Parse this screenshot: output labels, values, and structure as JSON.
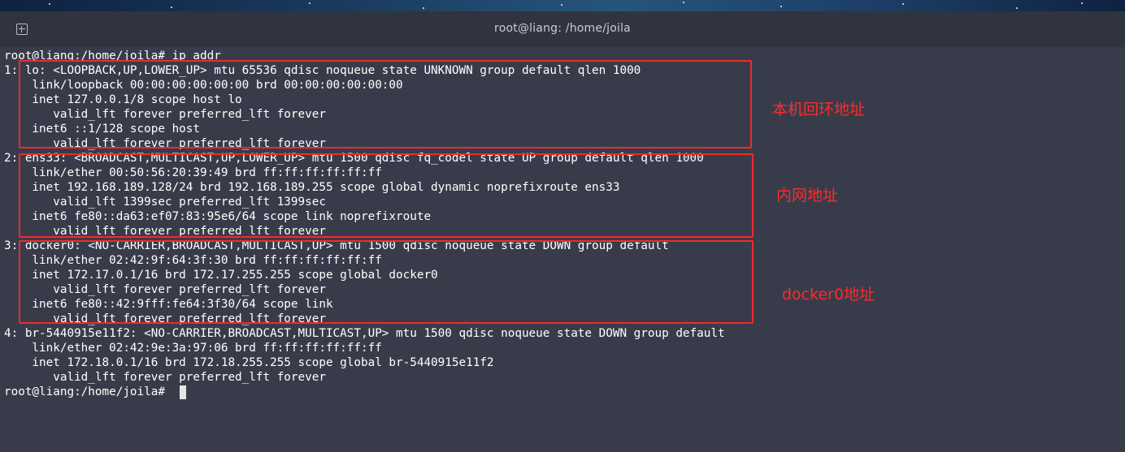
{
  "window": {
    "title": "root@liang: /home/joila",
    "new_tab_icon": "new-tab-icon"
  },
  "terminal": {
    "lines": [
      "root@liang:/home/joila# ip addr",
      "1: lo: <LOOPBACK,UP,LOWER_UP> mtu 65536 qdisc noqueue state UNKNOWN group default qlen 1000",
      "    link/loopback 00:00:00:00:00:00 brd 00:00:00:00:00:00",
      "    inet 127.0.0.1/8 scope host lo",
      "       valid_lft forever preferred_lft forever",
      "    inet6 ::1/128 scope host",
      "       valid_lft forever preferred_lft forever",
      "2: ens33: <BROADCAST,MULTICAST,UP,LOWER_UP> mtu 1500 qdisc fq_codel state UP group default qlen 1000",
      "    link/ether 00:50:56:20:39:49 brd ff:ff:ff:ff:ff:ff",
      "    inet 192.168.189.128/24 brd 192.168.189.255 scope global dynamic noprefixroute ens33",
      "       valid_lft 1399sec preferred_lft 1399sec",
      "    inet6 fe80::da63:ef07:83:95e6/64 scope link noprefixroute",
      "       valid_lft forever preferred_lft forever",
      "3: docker0: <NO-CARRIER,BROADCAST,MULTICAST,UP> mtu 1500 qdisc noqueue state DOWN group default",
      "    link/ether 02:42:9f:64:3f:30 brd ff:ff:ff:ff:ff:ff",
      "    inet 172.17.0.1/16 brd 172.17.255.255 scope global docker0",
      "       valid_lft forever preferred_lft forever",
      "    inet6 fe80::42:9fff:fe64:3f30/64 scope link",
      "       valid_lft forever preferred_lft forever",
      "4: br-5440915e11f2: <NO-CARRIER,BROADCAST,MULTICAST,UP> mtu 1500 qdisc noqueue state DOWN group default",
      "    link/ether 02:42:9e:3a:97:06 brd ff:ff:ff:ff:ff:ff",
      "    inet 172.18.0.1/16 brd 172.18.255.255 scope global br-5440915e11f2",
      "       valid_lft forever preferred_lft forever",
      "root@liang:/home/joila# "
    ]
  },
  "annotations": {
    "loopback": "本机回环地址",
    "lan": "内网地址",
    "docker0": "docker0地址",
    "highlight_color": "#f22a2a"
  },
  "colors": {
    "terminal_bg": "#383c4a",
    "titlebar_bg": "#2f343f",
    "text": "#ffffff"
  }
}
